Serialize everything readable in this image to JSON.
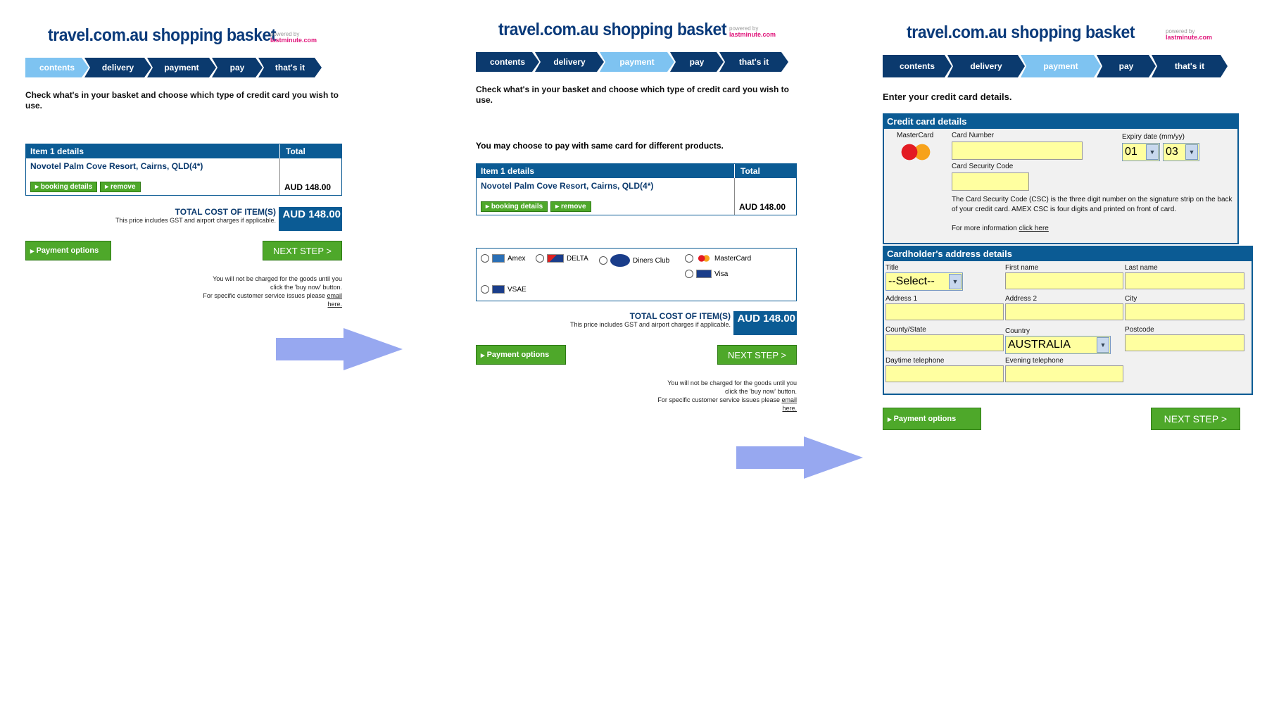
{
  "brand": {
    "logo": "travel.com.au shopping basket",
    "powered_by": "powered by",
    "powered_brand": "lastminute.com"
  },
  "steps": [
    "contents",
    "delivery",
    "payment",
    "pay",
    "that's it"
  ],
  "panel1": {
    "intro": "Check what's in your basket and choose which type of credit card you wish to use.",
    "item_header": "Item 1 details",
    "total_header": "Total",
    "item_name": "Novotel Palm Cove Resort, Cairns, QLD(4*)",
    "booking_details": "booking details",
    "remove": "remove",
    "item_total": "AUD 148.00",
    "total_label": "TOTAL COST OF ITEM(S)",
    "total_note": "This price includes GST and airport charges if applicable.",
    "total_amount": "AUD 148.00",
    "payment_options": "Payment options",
    "next_step": "NEXT STEP >",
    "foot1": "You will not be charged for the goods until you",
    "foot2": "click the 'buy now' button.",
    "foot3": "For specific customer service issues please",
    "foot_link1": "email",
    "foot_link2": "here."
  },
  "panel2": {
    "intro": "Check what's in your basket and choose which type of credit card you wish to use.",
    "note": "You may choose to pay with same card for different products.",
    "item_header": "Item 1 details",
    "total_header": "Total",
    "item_name": "Novotel Palm Cove Resort, Cairns, QLD(4*)",
    "booking_details": "booking details",
    "remove": "remove",
    "item_total": "AUD 148.00",
    "cards": [
      "Amex",
      "DELTA",
      "Diners Club",
      "MasterCard",
      "Visa",
      "VSAE"
    ],
    "total_label": "TOTAL COST OF ITEM(S)",
    "total_note": "This price includes GST and airport charges if applicable.",
    "total_amount": "AUD 148.00",
    "payment_options": "Payment options",
    "next_step": "NEXT STEP >",
    "foot1": "You will not be charged for the goods until you",
    "foot2": "click the 'buy now' button.",
    "foot3": "For specific customer service issues please",
    "foot_link1": "email",
    "foot_link2": "here."
  },
  "panel3": {
    "intro": "Enter your credit card details.",
    "cc_title": "Credit card details",
    "card_type": "MasterCard",
    "card_number_label": "Card Number",
    "expiry_label": "Expiry date (mm/yy)",
    "expiry_month": "01",
    "expiry_year": "03",
    "csc_label": "Card Security Code",
    "csc_help": "The Card Security Code (CSC) is the three digit number on the signature strip on the back of your credit card. AMEX CSC is four digits and printed on front of card.",
    "more_info": "For more information",
    "click_here": "click here",
    "addr_title": "Cardholder's address details",
    "title_label": "Title",
    "title_value": "--Select--",
    "first_name": "First name",
    "last_name": "Last name",
    "address1": "Address 1",
    "address2": "Address 2",
    "city": "City",
    "county": "County/State",
    "country": "Country",
    "country_value": "AUSTRALIA",
    "postcode": "Postcode",
    "day_tel": "Daytime telephone",
    "eve_tel": "Evening telephone",
    "payment_options": "Payment options",
    "next_step": "NEXT STEP >"
  },
  "colors": {
    "navy": "#0b3a6e",
    "accent": "#7ec3f1",
    "green": "#4ea82a",
    "field": "#ffffa0",
    "arrow": "#97a8f0"
  }
}
